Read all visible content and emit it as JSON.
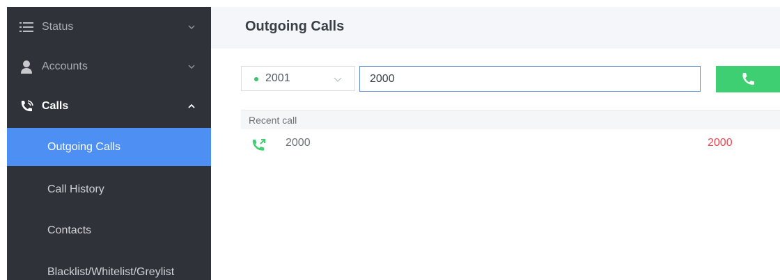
{
  "sidebar": {
    "items": [
      {
        "label": "Status",
        "icon": "list-icon",
        "expanded": false
      },
      {
        "label": "Accounts",
        "icon": "user-icon",
        "expanded": false
      },
      {
        "label": "Calls",
        "icon": "phone-wave-icon",
        "expanded": true
      }
    ],
    "sub_items": [
      {
        "label": "Outgoing Calls",
        "active": true
      },
      {
        "label": "Call History",
        "active": false
      },
      {
        "label": "Contacts",
        "active": false
      },
      {
        "label": "Blacklist/Whitelist/Greylist",
        "active": false
      }
    ]
  },
  "main": {
    "title": "Outgoing Calls",
    "account_select": {
      "value": "2001",
      "status_color": "#39c36b"
    },
    "dial_input": {
      "value": "2000"
    },
    "call_button": {
      "icon": "phone-icon",
      "color": "#3fcf73"
    },
    "recent": {
      "header": "Recent call",
      "rows": [
        {
          "icon": "outgoing-call-icon",
          "number": "2000",
          "name": "2000"
        }
      ]
    }
  },
  "colors": {
    "sidebar_bg": "#2f3238",
    "active_bg": "#4d8ff2",
    "accent_green": "#3fcf73",
    "contact_red": "#f0464d"
  }
}
